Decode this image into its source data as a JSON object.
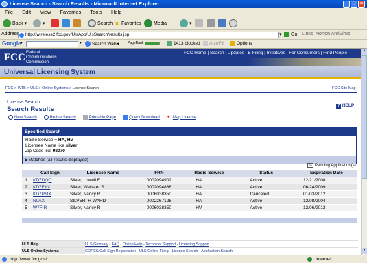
{
  "window": {
    "title": "License Search - Search Results - Microsoft Internet Explorer"
  },
  "menu": [
    "File",
    "Edit",
    "View",
    "Favorites",
    "Tools",
    "Help"
  ],
  "toolbar": {
    "back": "Back",
    "search": "Search",
    "favorites": "Favorites",
    "media": "Media",
    "go": "Go",
    "links": "Links",
    "norton": "Norton AntiVirus"
  },
  "address": {
    "label": "Address",
    "url": "http://wireless2.fcc.gov/UlsApp/UlsSearch/results.jsp"
  },
  "google": {
    "label": "Google",
    "search_web": "Search Web",
    "pagerank": "PageRank",
    "blocked": "1413 blocked",
    "autofill": "AutoFill",
    "options": "Options"
  },
  "fcc": {
    "logo": "FCC",
    "name": [
      "Federal",
      "Communications",
      "Commission"
    ],
    "links": [
      "FCC Home",
      "Search",
      "Updates",
      "E-Filing",
      "Initiatives",
      "For Consumers",
      "Find People"
    ]
  },
  "uls": {
    "title": "Universal Licensing System"
  },
  "breadcrumb": {
    "items": [
      "FCC",
      "WTB",
      "ULS",
      "Online Systems"
    ],
    "current": "License Search",
    "sitemap": "FCC Site Map"
  },
  "page": {
    "subtitle": "License Search",
    "title": "Search Results",
    "help": "HELP"
  },
  "actions": [
    "New Search",
    "Refine Search",
    "Printable Page",
    "Query Download",
    "Map License"
  ],
  "specified": {
    "header": "Specified Search",
    "lines": [
      {
        "label": "Radio Service = ",
        "value": "HA, HV"
      },
      {
        "label": "Licensee Name like ",
        "value": "silver"
      },
      {
        "label": "Zip Code like ",
        "value": "98070"
      }
    ],
    "matches_count": "5",
    "matches_text": " Matches (all results displayed)"
  },
  "pending": "Pending Application(s)",
  "results": {
    "headers": [
      "",
      "Call Sign",
      "Licensee Name",
      "FRN",
      "Radio Service",
      "Status",
      "Expiration Date"
    ],
    "rows": [
      [
        "1",
        "KD7DQO",
        "Silver, Lowell E",
        "0002094902",
        "HA",
        "Active",
        "12/21/2008"
      ],
      [
        "2",
        "KD7FYX",
        "Silver, Webster S",
        "0002094886",
        "HA",
        "Active",
        "06/24/2009"
      ],
      [
        "3",
        "KD7PMX",
        "Silver, Nancy R",
        "0006038350",
        "HA",
        "Canceled",
        "01/03/2012"
      ],
      [
        "4",
        "N0AX",
        "SILVER, H WARD",
        "0002267128",
        "HA",
        "Active",
        "12/08/2004"
      ],
      [
        "5",
        "W7FIR",
        "Silver, Nancy R",
        "0006038350",
        "HV",
        "Active",
        "12/06/2012"
      ]
    ]
  },
  "footer": {
    "uls_help_label": "ULS Help",
    "uls_help_links": [
      "ULS Glossary",
      "FAQ",
      "Online Help",
      "Technical Support",
      "Licensing Support"
    ],
    "uls_online_label": "ULS Online Systems",
    "uls_online_links": [
      "CORES/Call Sign Registration",
      "ULS Online Filing",
      "License Search",
      "Application Search"
    ]
  },
  "status": {
    "url": "http://www.fcc.gov/",
    "zone": "Internet"
  },
  "colors": {
    "fcc_blue": "#1d3a8a",
    "xp_title": "#0a5fdc",
    "gold": "#e2b400"
  }
}
